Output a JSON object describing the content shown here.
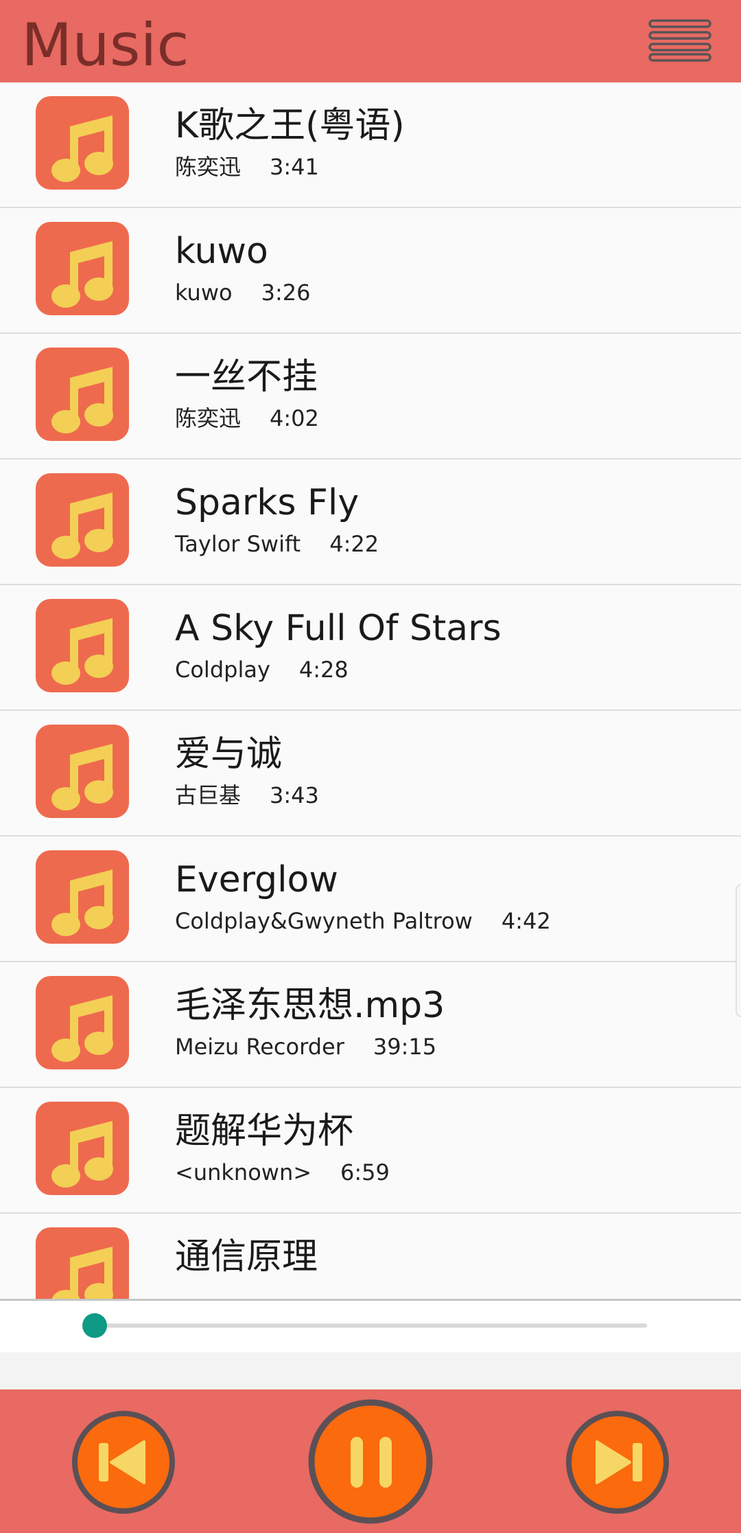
{
  "app": {
    "title": "Music",
    "accent_color": "#e86a62",
    "menu_icon": "hamburger-menu-icon"
  },
  "songs": [
    {
      "title": "K歌之王(粤语)",
      "artist": "陈奕迅",
      "duration": "3:41"
    },
    {
      "title": "kuwo",
      "artist": "kuwo",
      "duration": "3:26"
    },
    {
      "title": "一丝不挂",
      "artist": "陈奕迅",
      "duration": "4:02"
    },
    {
      "title": "Sparks Fly",
      "artist": "Taylor Swift",
      "duration": "4:22"
    },
    {
      "title": "A Sky Full Of Stars",
      "artist": "Coldplay",
      "duration": "4:28"
    },
    {
      "title": "爱与诚",
      "artist": "古巨基",
      "duration": "3:43"
    },
    {
      "title": "Everglow",
      "artist": "Coldplay&Gwyneth Paltrow",
      "duration": "4:42"
    },
    {
      "title": "毛泽东思想.mp3",
      "artist": "Meizu Recorder",
      "duration": "39:15"
    },
    {
      "title": "题解华为杯",
      "artist": "<unknown>",
      "duration": "6:59"
    },
    {
      "title": "通信原理",
      "artist": "",
      "duration": ""
    }
  ],
  "song_icon": "music-note-icon",
  "player": {
    "progress": 0.0,
    "progress_color": "#0e9a85",
    "buttons": [
      "previous-icon",
      "pause-icon",
      "next-icon"
    ]
  }
}
